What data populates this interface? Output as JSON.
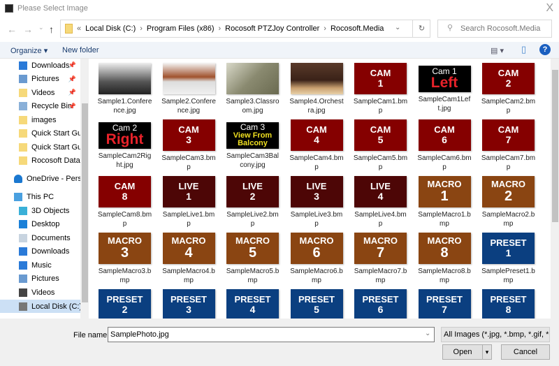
{
  "window": {
    "title": "Please Select Image",
    "close": "X"
  },
  "nav": {
    "back": "←",
    "forward": "→",
    "recent": "⌄",
    "up": "↑"
  },
  "address": {
    "prefix": "«",
    "crumbs": [
      "Local Disk (C:)",
      "Program Files (x86)",
      "Rocosoft PTZJoy Controller",
      "Rocosoft.Media"
    ],
    "refresh": "↻",
    "dropdown": "⌄"
  },
  "search": {
    "placeholder": "Search Rocosoft.Media",
    "icon": "⚲"
  },
  "toolbar": {
    "organize": "Organize ▾",
    "new_folder": "New folder",
    "view": "▤ ▾",
    "pane": "▯",
    "help": "?"
  },
  "sidebar": {
    "items": [
      {
        "label": "Downloads",
        "icon": "download-icon",
        "pinned": true
      },
      {
        "label": "Pictures",
        "icon": "pictures-icon",
        "pinned": true
      },
      {
        "label": "Videos",
        "icon": "folder-icon",
        "pinned": true
      },
      {
        "label": "Recycle Bin",
        "icon": "recycle-bin-icon",
        "pinned": true
      },
      {
        "label": "images",
        "icon": "folder-icon"
      },
      {
        "label": "Quick Start Guid",
        "icon": "folder-icon"
      },
      {
        "label": "Quick Start Guid",
        "icon": "folder-icon"
      },
      {
        "label": "Rocosoft Databa",
        "icon": "folder-icon"
      },
      {
        "label": "OneDrive - Persor",
        "icon": "onedrive-icon",
        "level": 0
      },
      {
        "label": "This PC",
        "icon": "pc-icon",
        "level": 0
      },
      {
        "label": "3D Objects",
        "icon": "3d-objects-icon"
      },
      {
        "label": "Desktop",
        "icon": "desktop-icon"
      },
      {
        "label": "Documents",
        "icon": "documents-icon"
      },
      {
        "label": "Downloads",
        "icon": "download-icon"
      },
      {
        "label": "Music",
        "icon": "music-icon"
      },
      {
        "label": "Pictures",
        "icon": "pictures-icon"
      },
      {
        "label": "Videos",
        "icon": "videos-icon"
      },
      {
        "label": "Local Disk (C:)",
        "icon": "drive-icon",
        "selected": true
      }
    ]
  },
  "colors": {
    "cam": "#850000",
    "live": "#4d0606",
    "macro": "#8a4512",
    "preset": "#0b3f80",
    "black": "#000000"
  },
  "files": [
    {
      "name": "Sample1.Conference.jpg",
      "kind": "photo",
      "bg": "linear-gradient(#eee,#555 60%,#222)"
    },
    {
      "name": "Sample2.Conference.jpg",
      "kind": "photo",
      "bg": "linear-gradient(#f5f5f5,#a0522d 45%,#ddd 60%,#f0f0f0)"
    },
    {
      "name": "Sample3.Classroom.jpg",
      "kind": "photo",
      "bg": "linear-gradient(135deg,#d8d8c8,#8a8a70 50%,#6a6a50)"
    },
    {
      "name": "Sample4.Orchestra.jpg",
      "kind": "photo",
      "bg": "linear-gradient(#5a3a2a,#3a2218 55%,#c9a070 80%,#e8d0a8)"
    },
    {
      "name": "SampleCam1.bmp",
      "kind": "cam",
      "l1": "CAM",
      "l2": "1"
    },
    {
      "name": "SampleCam1Left.jpg",
      "kind": "black",
      "l1": "Cam 1",
      "l2": "Left",
      "c2": "#e8222a"
    },
    {
      "name": "SampleCam2.bmp",
      "kind": "cam",
      "l1": "CAM",
      "l2": "2"
    },
    {
      "name": "SampleCam2Right.jpg",
      "kind": "black",
      "l1": "Cam 2",
      "l2": "Right",
      "c2": "#e8222a"
    },
    {
      "name": "SampleCam3.bmp",
      "kind": "cam",
      "l1": "CAM",
      "l2": "3"
    },
    {
      "name": "SampleCam3Balcony.jpg",
      "kind": "black",
      "l1": "Cam 3",
      "l2": "View From Balcony",
      "c2": "#f0e020"
    },
    {
      "name": "SampleCam4.bmp",
      "kind": "cam",
      "l1": "CAM",
      "l2": "4"
    },
    {
      "name": "SampleCam5.bmp",
      "kind": "cam",
      "l1": "CAM",
      "l2": "5"
    },
    {
      "name": "SampleCam6.bmp",
      "kind": "cam",
      "l1": "CAM",
      "l2": "6"
    },
    {
      "name": "SampleCam7.bmp",
      "kind": "cam",
      "l1": "CAM",
      "l2": "7"
    },
    {
      "name": "SampleCam8.bmp",
      "kind": "cam",
      "l1": "CAM",
      "l2": "8"
    },
    {
      "name": "SampleLive1.bmp",
      "kind": "live",
      "l1": "LIVE",
      "l2": "1"
    },
    {
      "name": "SampleLive2.bmp",
      "kind": "live",
      "l1": "LIVE",
      "l2": "2"
    },
    {
      "name": "SampleLive3.bmp",
      "kind": "live",
      "l1": "LIVE",
      "l2": "3"
    },
    {
      "name": "SampleLive4.bmp",
      "kind": "live",
      "l1": "LIVE",
      "l2": "4"
    },
    {
      "name": "SampleMacro1.bmp",
      "kind": "macro",
      "l1": "MACRO",
      "l2": "1"
    },
    {
      "name": "SampleMacro2.bmp",
      "kind": "macro",
      "l1": "MACRO",
      "l2": "2"
    },
    {
      "name": "SampleMacro3.bmp",
      "kind": "macro",
      "l1": "MACRO",
      "l2": "3"
    },
    {
      "name": "SampleMacro4.bmp",
      "kind": "macro",
      "l1": "MACRO",
      "l2": "4"
    },
    {
      "name": "SampleMacro5.bmp",
      "kind": "macro",
      "l1": "MACRO",
      "l2": "5"
    },
    {
      "name": "SampleMacro6.bmp",
      "kind": "macro",
      "l1": "MACRO",
      "l2": "6"
    },
    {
      "name": "SampleMacro7.bmp",
      "kind": "macro",
      "l1": "MACRO",
      "l2": "7"
    },
    {
      "name": "SampleMacro8.bmp",
      "kind": "macro",
      "l1": "MACRO",
      "l2": "8"
    },
    {
      "name": "SamplePreset1.bmp",
      "kind": "preset",
      "l1": "PRESET",
      "l2": "1"
    },
    {
      "name": "",
      "kind": "preset",
      "l1": "PRESET",
      "l2": "2"
    },
    {
      "name": "",
      "kind": "preset",
      "l1": "PRESET",
      "l2": "3"
    },
    {
      "name": "",
      "kind": "preset",
      "l1": "PRESET",
      "l2": "4"
    },
    {
      "name": "",
      "kind": "preset",
      "l1": "PRESET",
      "l2": "5"
    },
    {
      "name": "",
      "kind": "preset",
      "l1": "PRESET",
      "l2": "6"
    },
    {
      "name": "",
      "kind": "preset",
      "l1": "PRESET",
      "l2": "7"
    },
    {
      "name": "",
      "kind": "preset",
      "l1": "PRESET",
      "l2": "8"
    }
  ],
  "footer": {
    "file_name_label": "File name:",
    "file_name_value": "SamplePhoto.jpg",
    "filter": "All Images (*.jpg, *.bmp, *.gif, *",
    "open": "Open",
    "open_split": "▾",
    "cancel": "Cancel"
  }
}
